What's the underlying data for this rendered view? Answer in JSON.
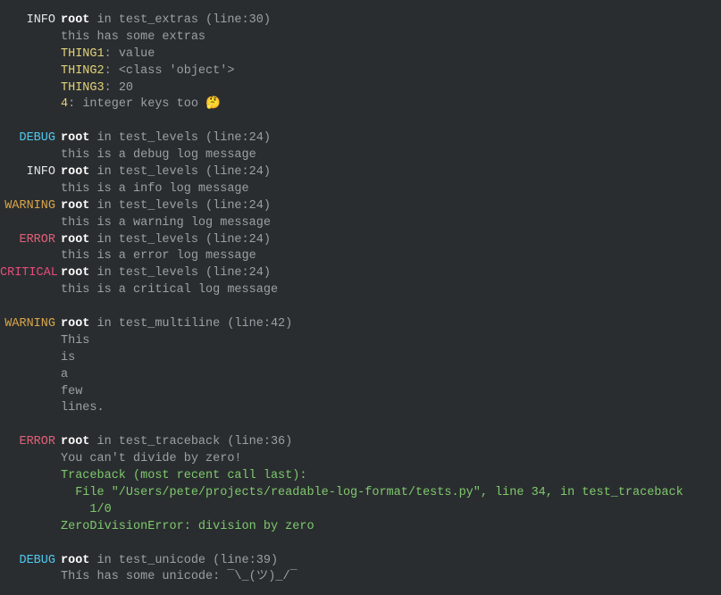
{
  "colors": {
    "background": "#2a2d2f",
    "default": "#9aa0a6",
    "logger": "#ffffff",
    "key": "#e0d27a",
    "traceback": "#7ec96e",
    "levels": {
      "INFO": "#e0e4e8",
      "DEBUG": "#4ec9f0",
      "WARNING": "#d8a54b",
      "ERROR": "#e2607a",
      "CRITICAL": "#e64c7c"
    }
  },
  "entries": [
    {
      "level": "INFO",
      "logger": "root",
      "context": "in test_extras (line:30)",
      "lines": [
        {
          "msg": "this has some extras"
        },
        {
          "key": "THING1",
          "sep": ": ",
          "val": "value"
        },
        {
          "key": "THING2",
          "sep": ": ",
          "val": "<class 'object'>"
        },
        {
          "key": "THING3",
          "sep": ": ",
          "val": "20"
        },
        {
          "key": "4",
          "sep": ": ",
          "val": "integer keys too 🤔"
        }
      ]
    },
    {
      "blank": true
    },
    {
      "level": "DEBUG",
      "logger": "root",
      "context": "in test_levels (line:24)",
      "lines": [
        {
          "msg": "this is a debug log message"
        }
      ]
    },
    {
      "level": "INFO",
      "logger": "root",
      "context": "in test_levels (line:24)",
      "lines": [
        {
          "msg": "this is a info log message"
        }
      ]
    },
    {
      "level": "WARNING",
      "logger": "root",
      "context": "in test_levels (line:24)",
      "lines": [
        {
          "msg": "this is a warning log message"
        }
      ]
    },
    {
      "level": "ERROR",
      "logger": "root",
      "context": "in test_levels (line:24)",
      "lines": [
        {
          "msg": "this is a error log message"
        }
      ]
    },
    {
      "level": "CRITICAL",
      "logger": "root",
      "context": "in test_levels (line:24)",
      "lines": [
        {
          "msg": "this is a critical log message"
        }
      ]
    },
    {
      "blank": true
    },
    {
      "level": "WARNING",
      "logger": "root",
      "context": "in test_multiline (line:42)",
      "lines": [
        {
          "msg": "This"
        },
        {
          "msg": "is"
        },
        {
          "msg": "a"
        },
        {
          "msg": "few"
        },
        {
          "msg": "lines."
        }
      ]
    },
    {
      "blank": true
    },
    {
      "level": "ERROR",
      "logger": "root",
      "context": "in test_traceback (line:36)",
      "lines": [
        {
          "msg": "You can't divide by zero!"
        },
        {
          "tb": "Traceback (most recent call last):"
        },
        {
          "tb": "  File \"/Users/pete/projects/readable-log-format/tests.py\", line 34, in test_traceback"
        },
        {
          "tb": "    1/0"
        },
        {
          "tb": "ZeroDivisionError: division by zero"
        }
      ]
    },
    {
      "blank": true
    },
    {
      "level": "DEBUG",
      "logger": "root",
      "context": "in test_unicode (line:39)",
      "lines": [
        {
          "msg": "Thís has some unicode: ¯\\_(ツ)_/¯"
        }
      ]
    }
  ]
}
